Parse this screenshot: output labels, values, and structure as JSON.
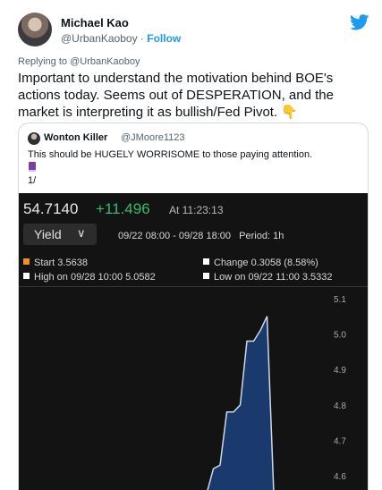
{
  "tweet": {
    "author_name": "Michael Kao",
    "handle": "@UrbanKaoboy",
    "separator": " · ",
    "follow_label": "Follow",
    "icon": "twitter-bird-icon",
    "brand_color": "#1d9bf0",
    "replying_to": "Replying to @UrbanKaoboy",
    "text": "Important to understand the motivation behind BOE's actions today. Seems out of DESPERATION, and the market is interpreting it as bullish/Fed Pivot. 👇"
  },
  "quoted": {
    "author_name": "Wonton Killer",
    "handle": "@JMoore1123",
    "text": "This should be HUGELY WORRISOME to those paying attention.",
    "emoji_icon": "purple-book-icon",
    "thread_num": "1/"
  },
  "chart": {
    "price": "54.7140",
    "change": "+11.496",
    "at_time": "At 11:23:13",
    "dropdown_label": "Yield",
    "range": "09/22 08:00 - 09/28 18:00",
    "period": "Period: 1h",
    "start": "Start  3.5638",
    "high": "High on 09/28 10:00  5.0582",
    "change_stat": "Change  0.3058 (8.58%)",
    "low": "Low on 09/22 11:00  3.5332",
    "up_color": "#2fbf6a",
    "fill_color": "#1a3a6e"
  },
  "chart_data": {
    "type": "area",
    "title": "",
    "xlabel": "",
    "ylabel": "",
    "yticks": [
      "5.1",
      "5.0",
      "4.9",
      "4.8",
      "4.7",
      "4.6"
    ],
    "ylim": [
      4.56,
      5.12
    ],
    "x": [
      0,
      1,
      2,
      3,
      4,
      5,
      6,
      7,
      8,
      9,
      10,
      11,
      12,
      13,
      14,
      15,
      16
    ],
    "values": [
      4.5,
      4.5,
      4.5,
      4.5,
      4.52,
      4.5,
      4.55,
      4.62,
      4.63,
      4.78,
      4.78,
      4.8,
      4.98,
      4.98,
      5.01,
      5.05,
      4.55
    ],
    "xlim": [
      -22,
      24
    ]
  }
}
